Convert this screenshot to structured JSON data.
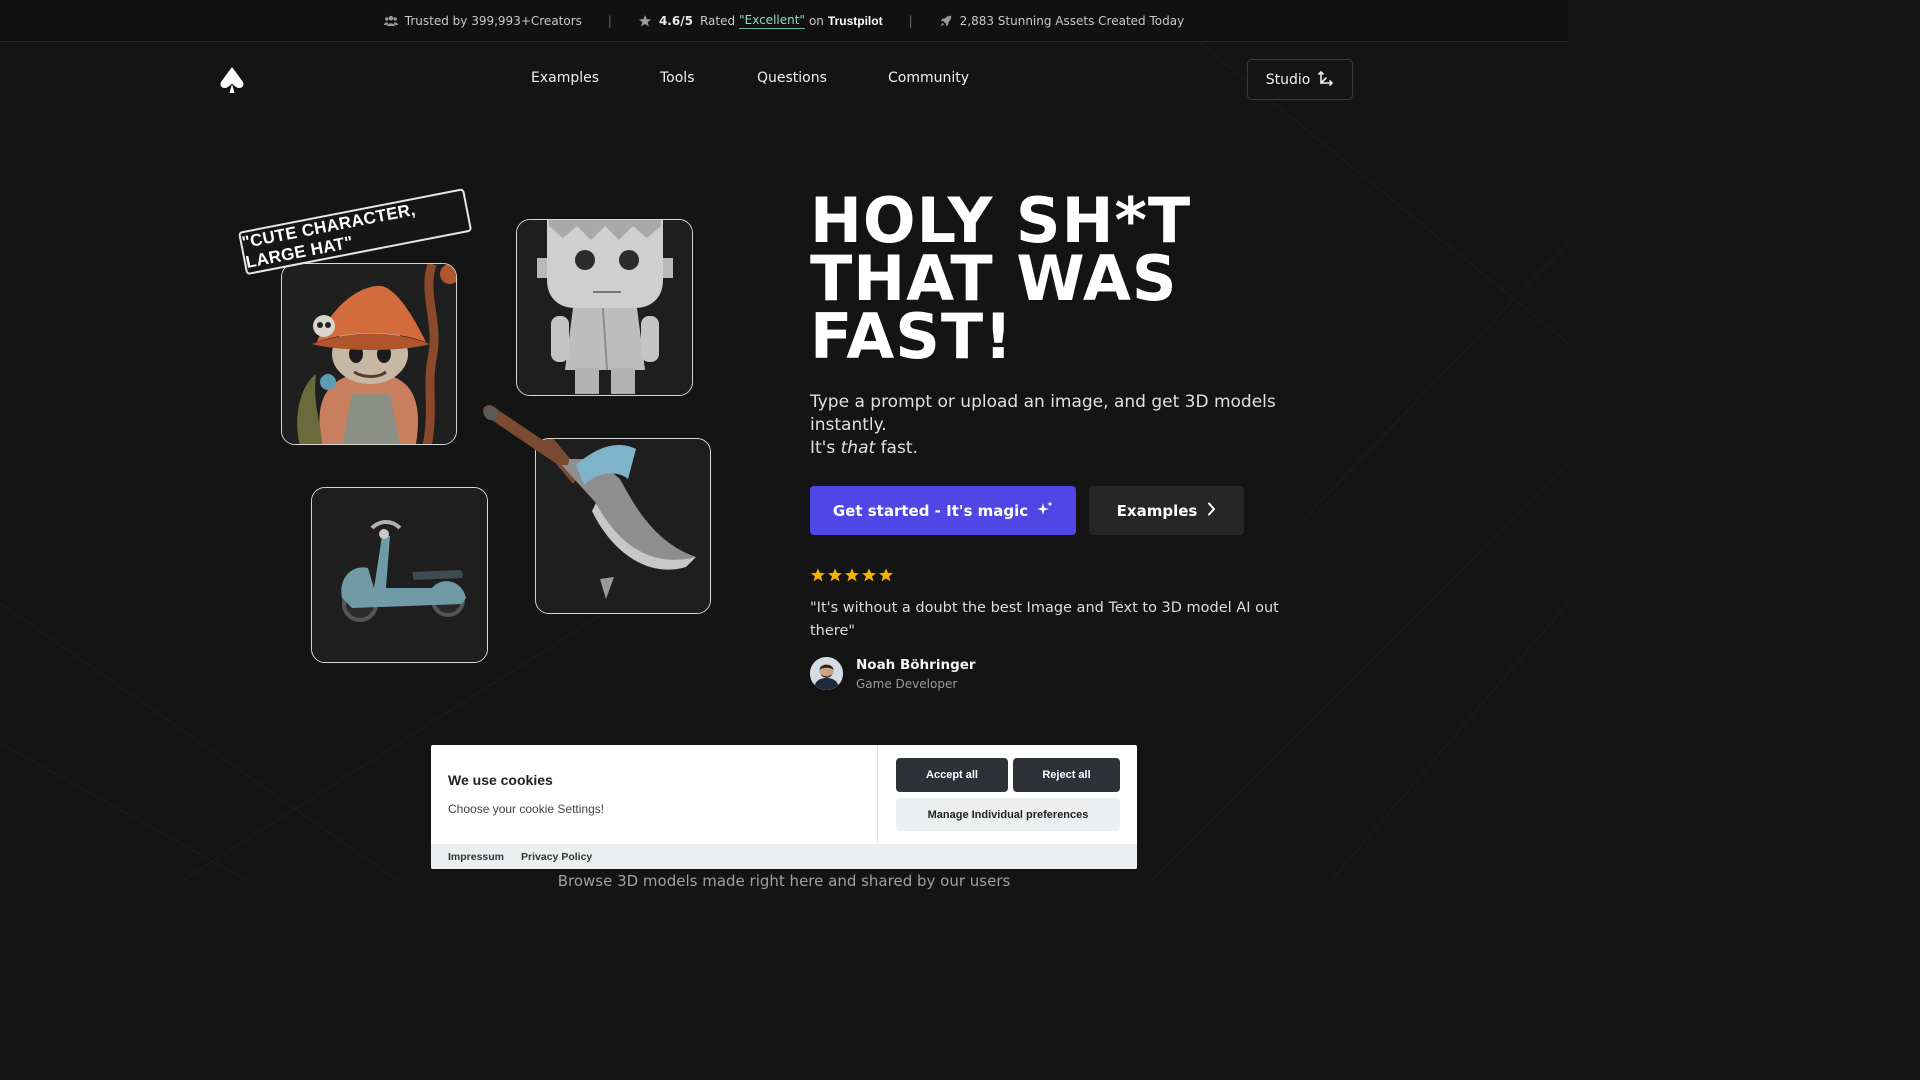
{
  "topbar": {
    "trusted": "Trusted by 399,993+Creators",
    "rating": "4.6/5",
    "rated_prefix": "Rated",
    "rated_value": "\"Excellent\"",
    "rated_on": "on",
    "trustpilot": "Trustpilot",
    "assets": "2,883 Stunning Assets Created Today",
    "separator": "|"
  },
  "nav": {
    "items": [
      "Examples",
      "Tools",
      "Questions",
      "Community"
    ],
    "studio_label": "Studio"
  },
  "hero": {
    "tag": "\"CUTE CHARACTER, LARGE HAT\"",
    "headline_1": "HOLY SH*T",
    "headline_2": "THAT WAS",
    "headline_3": "FAST!",
    "sub_1": "Type a prompt or upload an image, and get 3D models instantly.",
    "sub_2a": "It's",
    "sub_2b": "that",
    "sub_2c": "fast.",
    "cta_primary": "Get started - It's magic",
    "cta_secondary": "Examples",
    "rating_stars": 5,
    "quote": "\"It's without a doubt the best Image and Text to 3D model AI out there\"",
    "author_name": "Noah Böhringer",
    "author_role": "Game Developer",
    "browse_text": "Browse 3D models made right here and shared by our users"
  },
  "cookie": {
    "title": "We use cookies",
    "description": "Choose your cookie Settings!",
    "accept": "Accept all",
    "reject": "Reject all",
    "manage": "Manage Individual preferences",
    "impressum": "Impressum",
    "privacy": "Privacy Policy"
  },
  "colors": {
    "background": "#141414",
    "primary": "#4f46e5",
    "star": "#f5b301",
    "excellent": "#8fdcc4"
  },
  "icons": [
    "users-icon",
    "star-icon",
    "rocket-icon",
    "logo-icon",
    "axis-icon",
    "sparkle-icon",
    "chevron-right-icon"
  ]
}
